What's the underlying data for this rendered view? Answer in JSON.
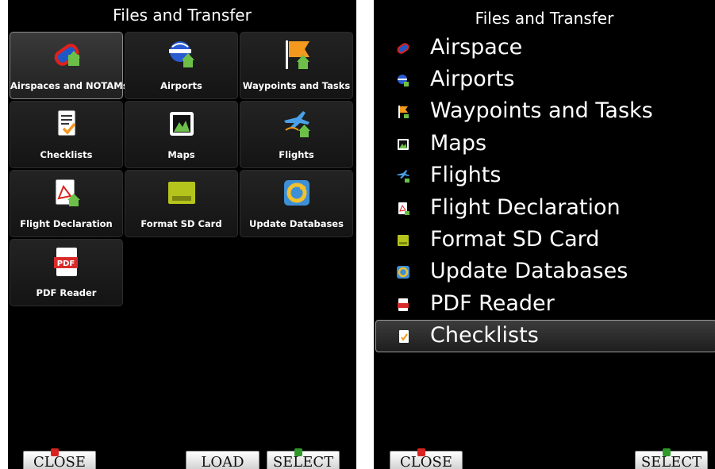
{
  "left_panel": {
    "title": "Files and Transfer",
    "tiles": [
      {
        "label": "Airspaces and NOTAMs",
        "icon": "airspace-icon"
      },
      {
        "label": "Airports",
        "icon": "airport-icon"
      },
      {
        "label": "Waypoints and Tasks",
        "icon": "waypoint-flag-icon"
      },
      {
        "label": "Checklists",
        "icon": "checklist-icon"
      },
      {
        "label": "Maps",
        "icon": "map-icon"
      },
      {
        "label": "Flights",
        "icon": "flights-icon"
      },
      {
        "label": "Flight Declaration",
        "icon": "flight-declaration-icon"
      },
      {
        "label": "Format SD Card",
        "icon": "sd-card-icon"
      },
      {
        "label": "Update Databases",
        "icon": "update-databases-icon"
      },
      {
        "label": "PDF Reader",
        "icon": "pdf-icon"
      }
    ],
    "pdf_icon_text": "PDF",
    "buttons": {
      "close": "CLOSE",
      "load": "LOAD",
      "select": "SELECT"
    }
  },
  "right_panel": {
    "title": "Files and Transfer",
    "items": [
      {
        "label": "Airspace",
        "icon": "airspace-icon"
      },
      {
        "label": "Airports",
        "icon": "airport-icon"
      },
      {
        "label": "Waypoints and Tasks",
        "icon": "waypoint-flag-icon"
      },
      {
        "label": "Maps",
        "icon": "map-icon"
      },
      {
        "label": "Flights",
        "icon": "flights-icon"
      },
      {
        "label": "Flight Declaration",
        "icon": "flight-declaration-icon"
      },
      {
        "label": "Format SD Card",
        "icon": "sd-card-icon"
      },
      {
        "label": "Update Databases",
        "icon": "update-databases-icon"
      },
      {
        "label": "PDF Reader",
        "icon": "pdf-icon"
      },
      {
        "label": "Checklists",
        "icon": "checklist-icon"
      }
    ],
    "buttons": {
      "close": "CLOSE",
      "select": "SELECT"
    }
  },
  "colors": {
    "accent_green": "#6cc04a",
    "accent_orange": "#f39a1e",
    "pdf_red": "#d92b2b",
    "close_mark": "#d9231f",
    "select_mark": "#2f9a2a"
  }
}
